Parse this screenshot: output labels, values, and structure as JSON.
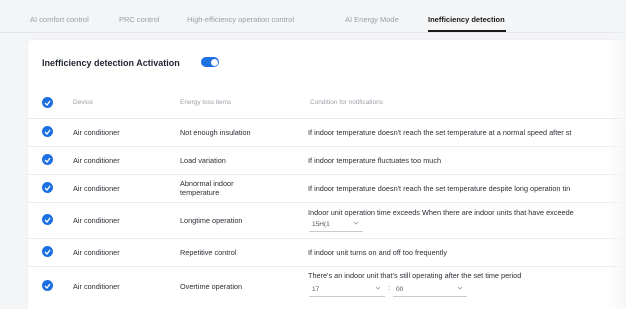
{
  "tabs": [
    {
      "label": "AI comfort control"
    },
    {
      "label": "PRC control"
    },
    {
      "label": "High-efficiency operation control"
    },
    {
      "label": "AI Energy Mode"
    },
    {
      "label": "Inefficiency detection"
    }
  ],
  "active_tab": "Inefficiency detection",
  "activation": {
    "label": "Inefficiency detection Activation",
    "enabled": true
  },
  "colors": {
    "accent": "#1e6fe0",
    "background": "#f4f5f7",
    "card": "#ffffff"
  },
  "table": {
    "headers": {
      "device": "Device",
      "item": "Energy loss items",
      "condition": "Condition for notifications"
    },
    "rows": [
      {
        "checked": true,
        "device": "Air conditioner",
        "item": "Not enough insulation",
        "condition": "If indoor temperature doesn't reach the set temperature at a normal speed after st"
      },
      {
        "checked": true,
        "device": "Air conditioner",
        "item": "Load variation",
        "condition": "If indoor temperature fluctuates too much"
      },
      {
        "checked": true,
        "device": "Air conditioner",
        "item": "Abnormal indoor temperature",
        "condition": "If indoor temperature doesn't reach the set temperature despite long operation tin"
      },
      {
        "checked": true,
        "device": "Air conditioner",
        "item": "Longtime operation",
        "condition": "Indoor unit operation time exceeds When there are indoor units that have exceede",
        "select_value": "15H(1"
      },
      {
        "checked": true,
        "device": "Air conditioner",
        "item": "Repetitive control",
        "condition": "If indoor unit turns on and off too frequently"
      },
      {
        "checked": true,
        "device": "Air conditioner",
        "item": "Overtime operation",
        "condition": "There's an indoor unit that's still operating after the set time period",
        "hour_value": "17",
        "separator": ":",
        "minute_value": "00"
      }
    ]
  }
}
